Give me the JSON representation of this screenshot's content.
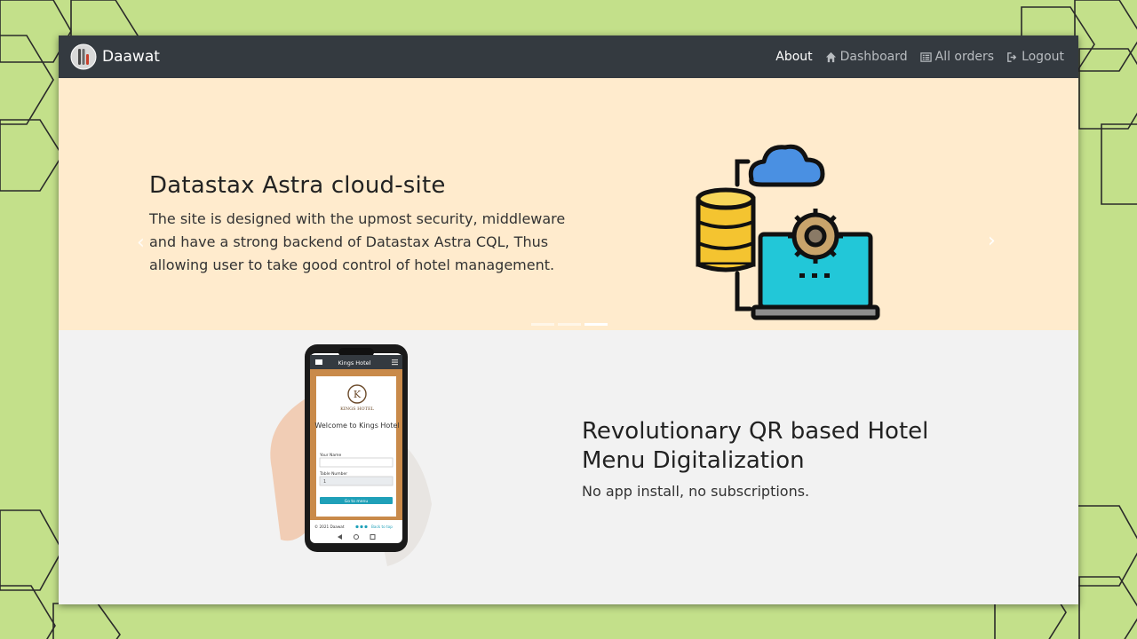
{
  "navbar": {
    "brand_name": "Daawat",
    "links": [
      {
        "label": "About",
        "icon": "none",
        "active": true
      },
      {
        "label": "Dashboard",
        "icon": "home-icon",
        "active": false
      },
      {
        "label": "All orders",
        "icon": "list-icon",
        "active": false
      },
      {
        "label": "Logout",
        "icon": "logout-icon",
        "active": false
      }
    ]
  },
  "hero": {
    "title": "Datastax Astra cloud-site",
    "text": "The site is designed with the upmost security, middleware and have a strong backend of Datastax Astra CQL, Thus allowing user to take good control of hotel management.",
    "prev_icon": "‹",
    "next_icon": "›",
    "active_slide": 3,
    "slide_count": 3
  },
  "feature": {
    "title": "Revolutionary QR based Hotel Menu Digitalization",
    "text": "No app install, no subscriptions."
  },
  "phone_screen": {
    "header_title": "Kings Hotel",
    "logo_letter": "K",
    "logo_text": "KINGS HOTEL",
    "welcome": "Welcome to Kings Hotel",
    "name_label": "Your Name",
    "table_label": "Table Number",
    "table_value": "1",
    "button_label": "Go to menu",
    "footer_text": "© 2021 Daawat",
    "footer_link": "Back to top"
  },
  "colors": {
    "page_bg": "#c3e08a",
    "navbar_bg": "#343a40",
    "hero_bg": "#ffebcd",
    "section_bg": "#f2f2f2",
    "accent_teal": "#1fa0b8"
  }
}
